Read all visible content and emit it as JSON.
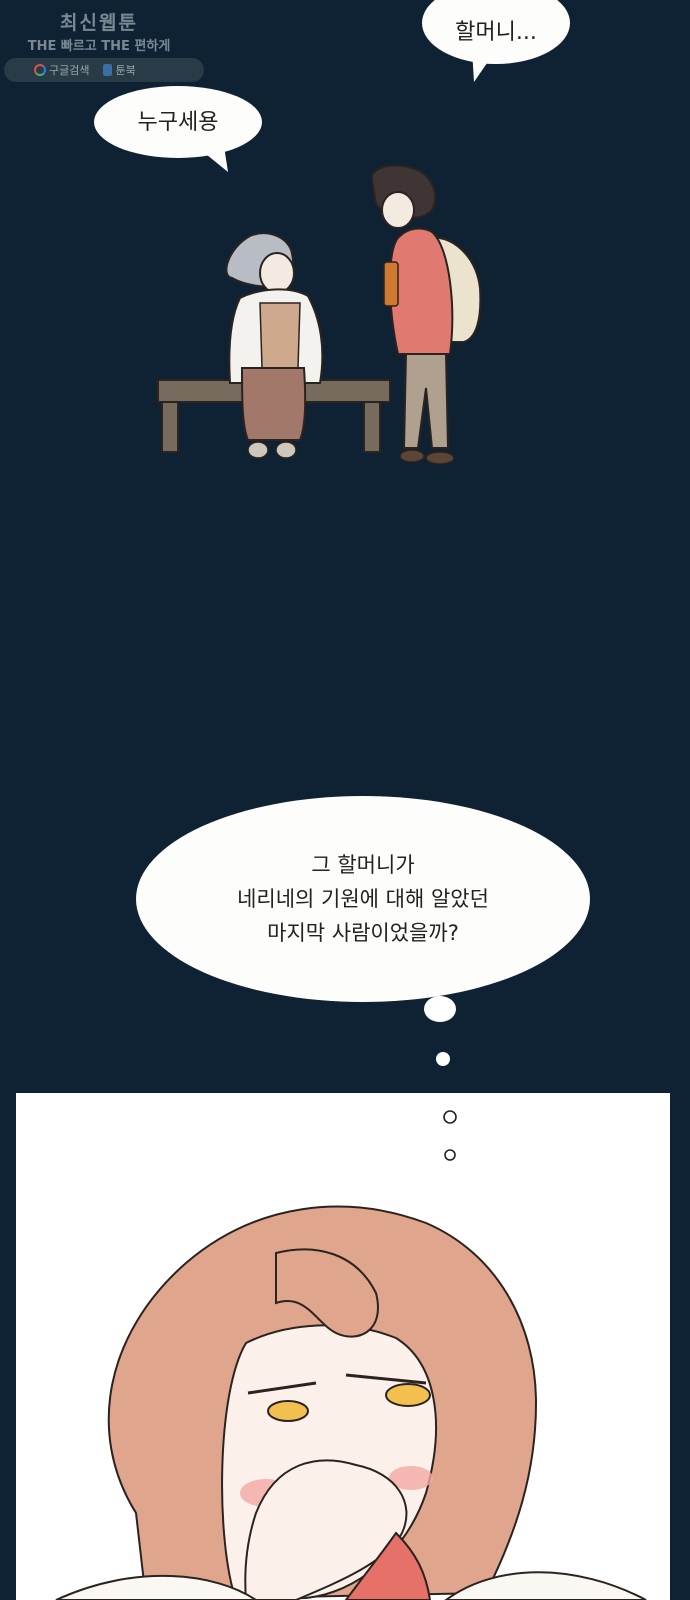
{
  "watermark": {
    "line1": "최신웹툰",
    "line2": "THE 빠르고 THE 편하게",
    "links": [
      {
        "label": "구글검색",
        "icon": "google-icon"
      },
      {
        "label": "툰북",
        "icon": "book-icon"
      }
    ]
  },
  "bubbles": {
    "boy": "할머니...",
    "grandma": "누구세용",
    "thought": [
      "그 할머니가",
      "네리네의 기원에 대해 알았던",
      "마지막 사람이었을까?"
    ]
  },
  "colors": {
    "background": "#0f2233",
    "bubble": "#fdfdfb",
    "hair": "#e0a58d",
    "boy_shirt": "#e07a70"
  }
}
